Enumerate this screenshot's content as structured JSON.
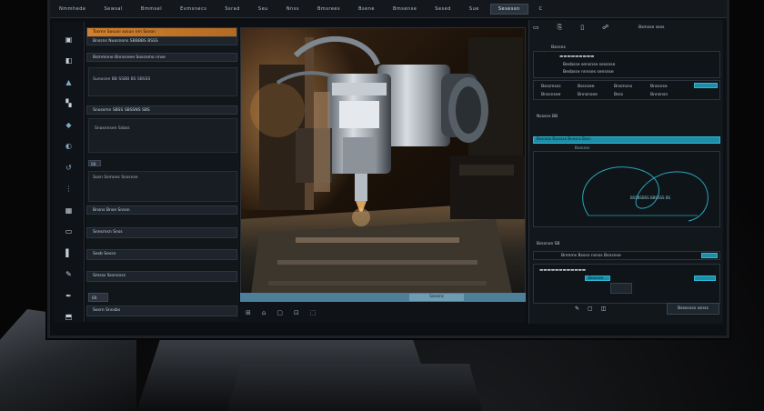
{
  "top": {
    "title": "▬ ▬▬▬▬▬▬▬",
    "icons": [
      "⋯",
      "⊕",
      "▣"
    ]
  },
  "menu": {
    "items": [
      {
        "label": "Nmmhede"
      },
      {
        "label": "Sewsal"
      },
      {
        "label": "Bmmsel"
      },
      {
        "label": "Evmsnecs"
      },
      {
        "label": "Ssrad"
      },
      {
        "label": "Seu"
      },
      {
        "label": "Nnss"
      },
      {
        "label": "Bmsrees"
      },
      {
        "label": "Bsene"
      },
      {
        "label": "Bmsense"
      },
      {
        "label": "Sesed"
      },
      {
        "label": "Sue"
      },
      {
        "label": "Sesessn"
      }
    ],
    "active_index": 12,
    "close_symbol": "C"
  },
  "left_panel": {
    "rows": [
      {
        "label": "Tosmn Sosuni sosun nm Ssnon"
      },
      {
        "label": "Bnssns Nuosnons SBBBBS BSSS"
      },
      {
        "label": "Bsmmnne Bnnssnee Sossnmo nnse"
      },
      {
        "label": "Sunosne BB SSBB BS SBSSS"
      },
      {
        "label": "Snossmn SBSS SBSSNS SBS"
      },
      {
        "label": "Snasnnsen Ssbss"
      },
      {
        "label": "Sosn Ssmons Snssnse"
      },
      {
        "label": "Bnsns Bnse Snssn"
      },
      {
        "label": "Snnsrnsn Snss"
      },
      {
        "label": "Sesb Sessn"
      },
      {
        "label": "Smsss Sssnsnss"
      },
      {
        "label": "Sesrn Snnsbs"
      }
    ],
    "small_labels": [
      "BB",
      "BB",
      "BB"
    ]
  },
  "viewport": {
    "status_icons": [
      "⊞",
      "⌂",
      "▢",
      "⊡",
      "⬚"
    ],
    "bar_chip": "Sssssns"
  },
  "right_panel": {
    "header": "Bsnsns",
    "top_btn": "Bsmsse sess",
    "section1": [
      "▬▬▬▬▬▬▬▬▬",
      "Besbsse sensnse sessnse",
      "Besbsse nnnses sensnse"
    ],
    "row_labels": [
      "Bsssmsss",
      "Bssnsee",
      "Bnsmsns",
      "Bnssnse",
      "Bnssnsee",
      "Bnnsnsee",
      "Bsss",
      "Bnnsnsn"
    ],
    "graph_title": "Bnsnsss Bsssssn Bnnsns Bssn",
    "graph_sub": "Nsssns BB",
    "graph_tag": "Bssnsns",
    "graph_chip": "BSSBSBSS BBSSSS BS",
    "section3": "Bsssnse SB",
    "section3_row": "Bnmms Bsssn nsnss Bsnsnse",
    "teal_pill": "Bssnsse",
    "bottom_btn": "Bssssnss ssnss",
    "bottom_icons": [
      "✎",
      "▢",
      "◫"
    ]
  },
  "colors": {
    "accent_orange": "#d4802a",
    "accent_teal": "#1d8ea8",
    "panel_bg": "#12171c"
  }
}
